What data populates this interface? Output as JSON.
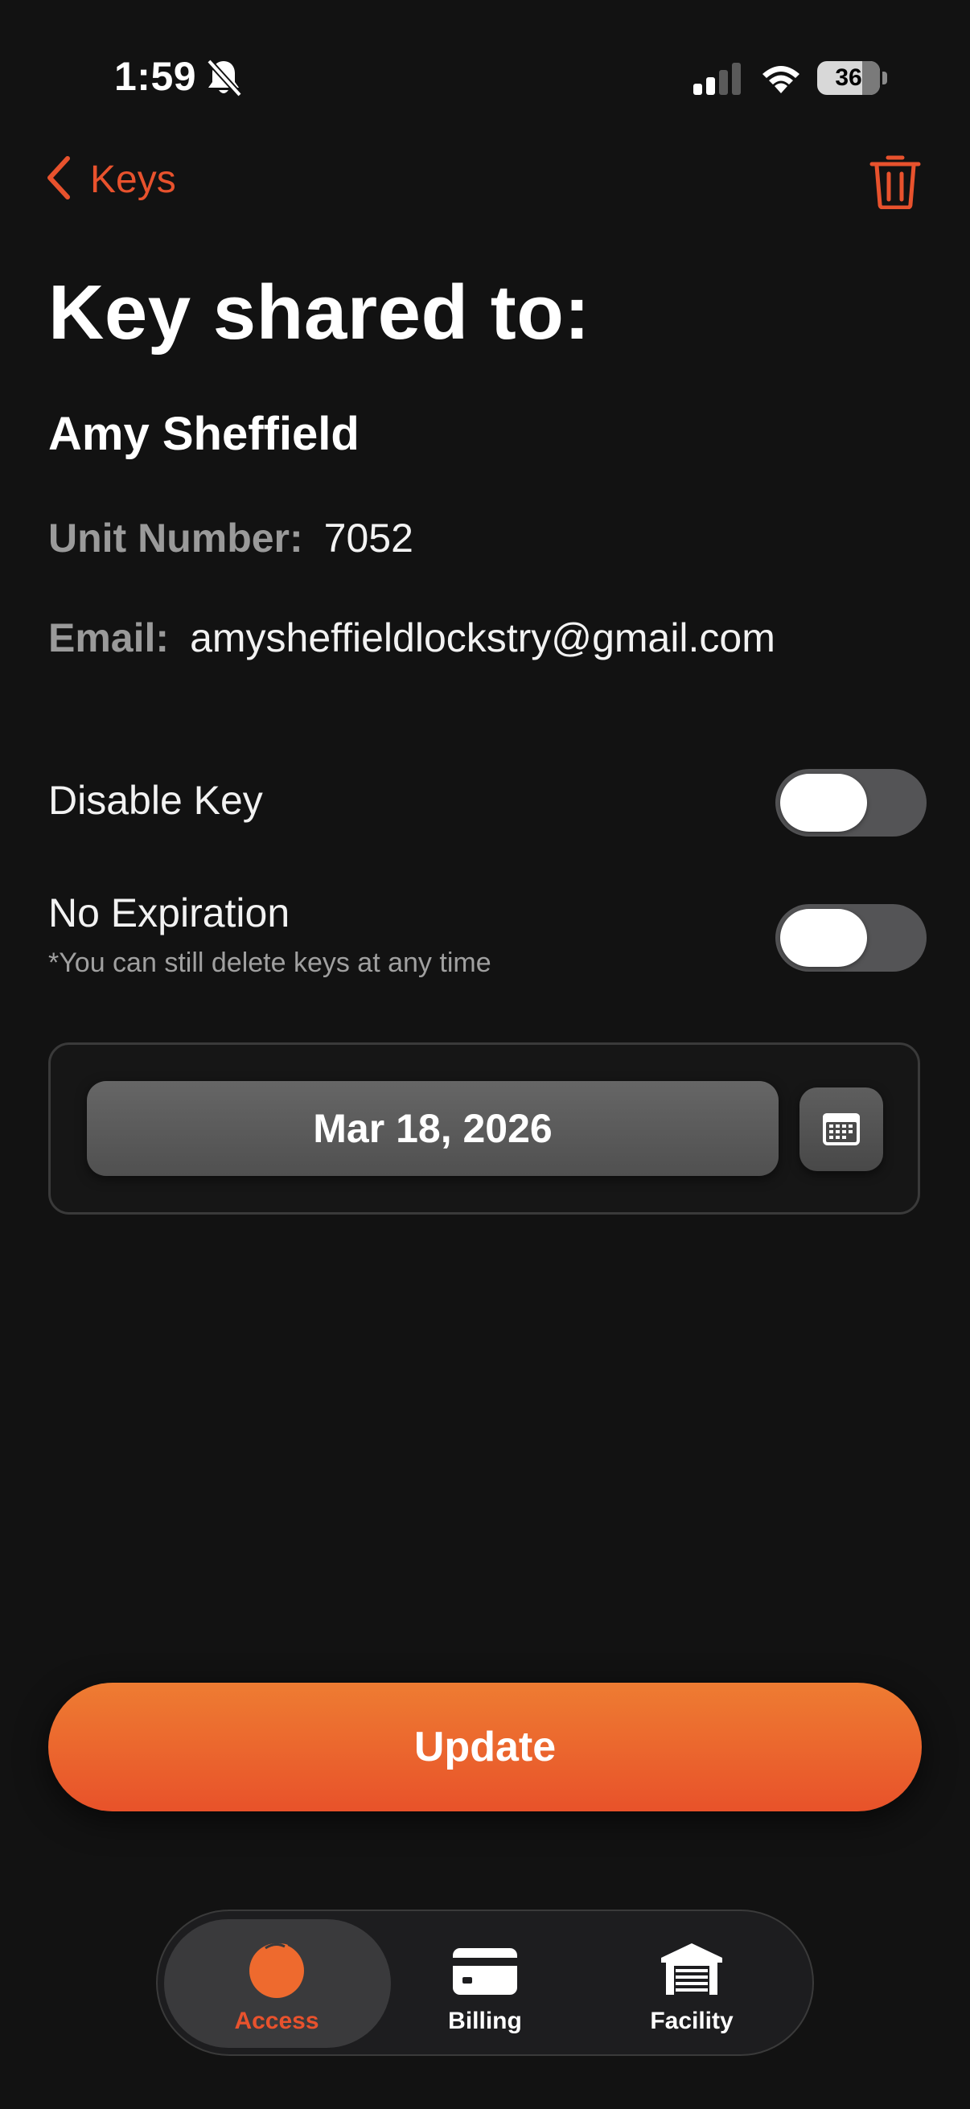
{
  "status_bar": {
    "time": "1:59",
    "battery": "36"
  },
  "nav": {
    "back_label": "Keys"
  },
  "page": {
    "title": "Key shared to:",
    "recipient_name": "Amy Sheffield",
    "unit_label": "Unit Number:",
    "unit_value": "7052",
    "email_label": "Email:",
    "email_value": "amysheffieldlockstry@gmail.com"
  },
  "toggles": {
    "disable_key": {
      "label": "Disable Key",
      "on": false
    },
    "no_expiration": {
      "label": "No Expiration",
      "sublabel": "*You can still delete keys at any time",
      "on": false
    }
  },
  "expiration": {
    "date": "Mar 18, 2026"
  },
  "actions": {
    "update_label": "Update"
  },
  "tabs": [
    {
      "label": "Access",
      "icon": "access-icon",
      "active": true
    },
    {
      "label": "Billing",
      "icon": "billing-icon",
      "active": false
    },
    {
      "label": "Facility",
      "icon": "facility-icon",
      "active": false
    }
  ],
  "colors": {
    "accent": "#e8522d",
    "accent_gradient_top": "#ee7c32",
    "background": "#121212"
  }
}
